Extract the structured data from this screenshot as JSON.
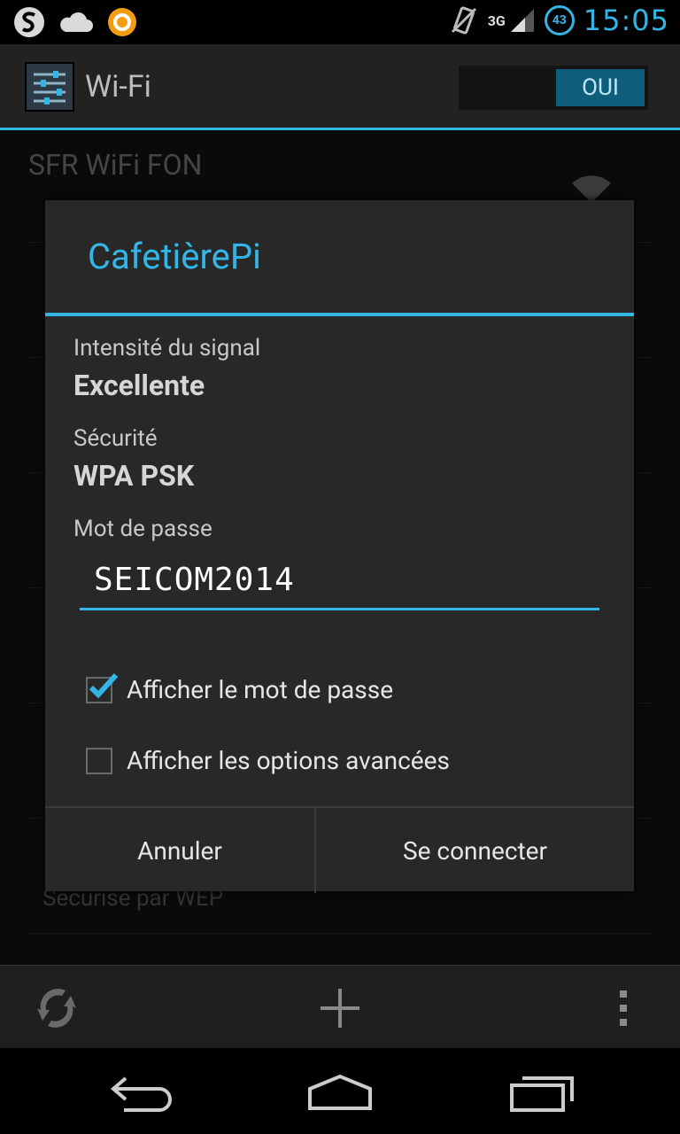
{
  "status_bar": {
    "time": "15:05",
    "network_label": "3G",
    "battery_level": "43",
    "left_icons": [
      "s-app-icon",
      "cloud-icon",
      "a-app-icon"
    ]
  },
  "action_bar": {
    "title": "Wi-Fi",
    "toggle_label": "OUI"
  },
  "background_list": [
    {
      "title": "SFR WiFi FON",
      "subtitle": ""
    },
    {
      "title": "",
      "subtitle": "Sécurisé par WEP"
    }
  ],
  "dialog": {
    "title": "CafetièrePi",
    "signal_label": "Intensité du signal",
    "signal_value": "Excellente",
    "security_label": "Sécurité",
    "security_value": "WPA PSK",
    "password_label": "Mot de passe",
    "password_value": "SEICOM2014",
    "show_password_label": "Afficher le mot de passe",
    "show_password_checked": true,
    "advanced_label": "Afficher les options avancées",
    "advanced_checked": false,
    "cancel_label": "Annuler",
    "connect_label": "Se connecter"
  },
  "colors": {
    "accent": "#33b5e5"
  }
}
